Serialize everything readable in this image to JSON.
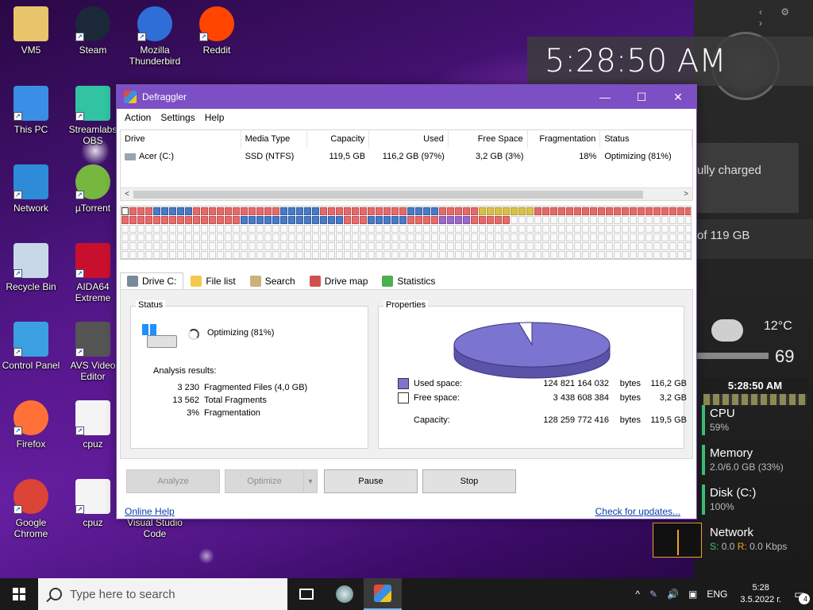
{
  "desktop_icons": [
    {
      "label": "VM5",
      "icon": "folder-user-icon"
    },
    {
      "label": "Steam",
      "icon": "steam-icon"
    },
    {
      "label": "Mozilla Thunderbird",
      "icon": "thunderbird-icon"
    },
    {
      "label": "Reddit",
      "icon": "reddit-icon"
    },
    {
      "label": "This PC",
      "icon": "computer-icon"
    },
    {
      "label": "Streamlabs OBS",
      "icon": "streamlabs-icon"
    },
    {
      "label": "Network",
      "icon": "network-icon"
    },
    {
      "label": "µTorrent",
      "icon": "utorrent-icon"
    },
    {
      "label": "Recycle Bin",
      "icon": "recycle-bin-icon"
    },
    {
      "label": "AIDA64 Extreme",
      "icon": "aida64-icon"
    },
    {
      "label": "Control Panel",
      "icon": "control-panel-icon"
    },
    {
      "label": "AVS Video Editor",
      "icon": "avs-video-icon"
    },
    {
      "label": "Firefox",
      "icon": "firefox-icon"
    },
    {
      "label": "cpuz",
      "icon": "cpuz-file-icon"
    },
    {
      "label": "Google Chrome",
      "icon": "chrome-icon"
    },
    {
      "label": "cpuz",
      "icon": "cpuz-file-icon"
    },
    {
      "label": "Visual Studio Code",
      "icon": "vscode-icon"
    }
  ],
  "widgets": {
    "digital_clock": "5:28:50 AM",
    "battery_text": "ully charged",
    "storage_text": "of 119 GB",
    "weather_temp": "12°C",
    "weather_value": "69",
    "small_clock": "5:28:50 AM",
    "cpu": {
      "title": "CPU",
      "value": "59%"
    },
    "memory": {
      "title": "Memory",
      "value": "2.0/6.0 GB (33%)"
    },
    "disk": {
      "title": "Disk (C:)",
      "value": "100%"
    },
    "network": {
      "title": "Network",
      "s_label": "S:",
      "s_value": "0.0",
      "r_label": "R:",
      "r_value": "0.0 Kbps"
    }
  },
  "window": {
    "title": "Defraggler",
    "controls": {
      "minimize": "—",
      "maximize": "☐",
      "close": "✕"
    },
    "menu": [
      "Action",
      "Settings",
      "Help"
    ],
    "drive_table": {
      "headers": [
        "Drive",
        "Media Type",
        "Capacity",
        "Used",
        "Free Space",
        "Fragmentation",
        "Status"
      ],
      "rows": [
        {
          "drive": "Acer (C:)",
          "media": "SSD (NTFS)",
          "capacity": "119,5 GB",
          "used": "116,2 GB (97%)",
          "free": "3,2 GB (3%)",
          "frag": "18%",
          "status": "Optimizing (81%)"
        }
      ]
    },
    "drive_map": {
      "legend": {
        "r": "fragmented",
        "b": "used",
        "y": "system",
        "p": "reserved",
        "s": "selected",
        "e": "free"
      },
      "rows": [
        "srrrbbbbbrrrrrrrrrrrbbbbbrrrrrrrrrrrbbbbrrrrryyyyyyyrrrrrrrrrrrrrrrrrrrr",
        "rrrrrrrrrrrrrrrbbbbbbbbbbbbbrrrbbbbbrrrrpppprrrrreeeeeeeeeeeeeeeeeeeeeee",
        "eeeeeeeeeeeeeeeeeeeeeeeeeeeeeeeeeeeeeeeeeeeeeeeeeeeeeeeeeeeeeeeeeeeeeeee",
        "eeeeeeeeeeeeeeeeeeeeeeeeeeeeeeeeeeeeeeeeeeeeeeeeeeeeeeeeeeeeeeeeeeeeeeee",
        "eeeeeeeeeeeeeeeeeeeeeeeeeeeeeeeeeeeeeeeeeeeeeeeeeeeeeeeeeeeeeeeeeeeeeeee",
        "eeeeeeeeeeeeeeeeeeeeeeeeeeeeeeeeeeeeeeeeeeeeeeeeeeeeeeeeeeeeeeeeeeeeeeee"
      ]
    },
    "tabs": [
      {
        "label": "Drive C:",
        "icon": "drive-icon",
        "color": "#7a8a9a"
      },
      {
        "label": "File list",
        "icon": "folder-icon",
        "color": "#f2c94c"
      },
      {
        "label": "Search",
        "icon": "search-icon",
        "color": "#c9b37a"
      },
      {
        "label": "Drive map",
        "icon": "drive-map-icon",
        "color": "#d05050"
      },
      {
        "label": "Statistics",
        "icon": "statistics-icon",
        "color": "#4caf50"
      }
    ],
    "status": {
      "legend": "Status",
      "text": "Optimizing (81%)",
      "analysis_label": "Analysis results:",
      "results": [
        {
          "n": "3 230",
          "label": "Fragmented Files (4,0 GB)"
        },
        {
          "n": "13 562",
          "label": "Total Fragments"
        },
        {
          "n": "3%",
          "label": "Fragmentation"
        }
      ]
    },
    "properties": {
      "legend": "Properties",
      "used_fraction": 0.973,
      "used_color": "#7b74d0",
      "free_color": "#ffffff",
      "rows": [
        {
          "label": "Used space:",
          "bytes": "124 821 164 032",
          "unit": "bytes",
          "gb": "116,2 GB"
        },
        {
          "label": "Free space:",
          "bytes": "3 438 608 384",
          "unit": "bytes",
          "gb": "3,2 GB"
        },
        {
          "label": "Capacity:",
          "bytes": "128 259 772 416",
          "unit": "bytes",
          "gb": "119,5 GB"
        }
      ]
    },
    "buttons": {
      "analyze": "Analyze",
      "optimize": "Optimize",
      "optimize_arrow": "▼",
      "pause": "Pause",
      "stop": "Stop"
    },
    "links": {
      "help": "Online Help",
      "updates": "Check for updates..."
    }
  },
  "taskbar": {
    "search_placeholder": "Type here to search",
    "tray": {
      "chevron": "^",
      "lang": "ENG",
      "time": "5:28",
      "date": "3.5.2022 г.",
      "notifications": "4"
    }
  }
}
